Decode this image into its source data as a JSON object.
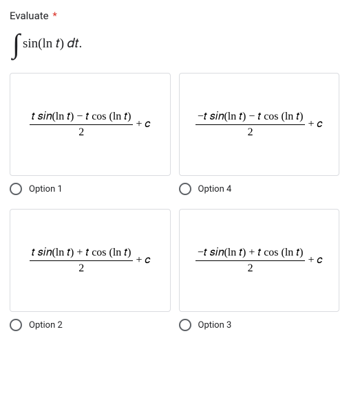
{
  "question": {
    "title": "Evaluate",
    "required_marker": "*",
    "integral_expr": "sin(ln 𝑡) 𝑑𝑡."
  },
  "options": [
    {
      "label": "Option 1",
      "numerator": "𝑡 𝑠𝑖𝑛(ln 𝑡) − 𝑡 cos (ln 𝑡)",
      "denominator": "2",
      "tail": "+ 𝑐"
    },
    {
      "label": "Option 4",
      "numerator": "−𝑡 𝑠𝑖𝑛(ln 𝑡) − 𝑡 cos (ln 𝑡)",
      "denominator": "2",
      "tail": "+ 𝑐"
    },
    {
      "label": "Option 2",
      "numerator": "𝑡 𝑠𝑖𝑛(ln 𝑡) + 𝑡 cos (ln 𝑡)",
      "denominator": "2",
      "tail": "+ 𝑐"
    },
    {
      "label": "Option 3",
      "numerator": "−𝑡 𝑠𝑖𝑛(ln 𝑡) + 𝑡 cos (ln 𝑡)",
      "denominator": "2",
      "tail": "+ 𝑐"
    }
  ]
}
